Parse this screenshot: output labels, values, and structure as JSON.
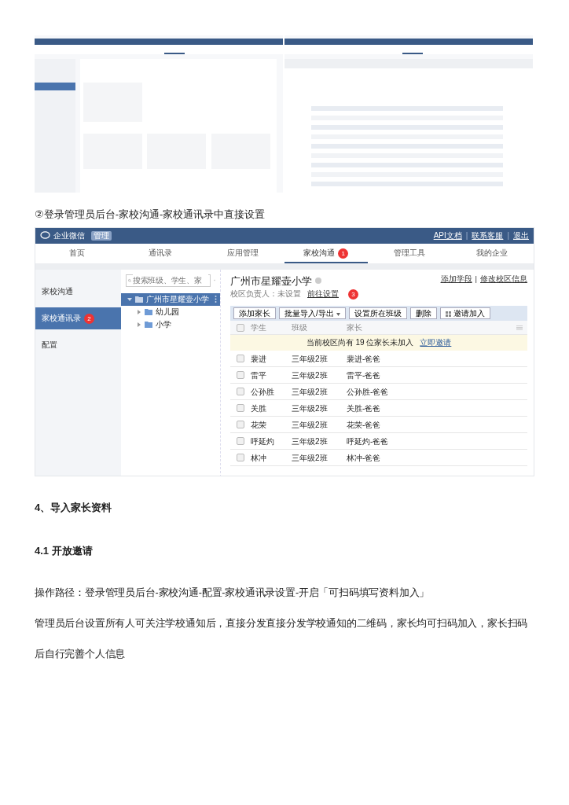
{
  "top_screenshots": [
    {
      "kind": "picture"
    },
    {
      "kind": "picture"
    }
  ],
  "caption": "②登录管理员后台-家校沟通-家校通讯录中直接设置",
  "app": {
    "logo": "企业微信",
    "logo_badge": "管理",
    "header_links": [
      "API文档",
      "联系客服",
      "退出"
    ],
    "header_separator": "|",
    "all_checked": false,
    "tabs": [
      {
        "label": "首页",
        "selected": false
      },
      {
        "label": "通讯录",
        "selected": false
      },
      {
        "label": "应用管理",
        "selected": false
      },
      {
        "label": "家校沟通",
        "selected": true,
        "badge": "1"
      },
      {
        "label": "管理工具",
        "selected": false
      },
      {
        "label": "我的企业",
        "selected": false
      }
    ],
    "sidebar": [
      {
        "label": "家校沟通",
        "selected": false
      },
      {
        "label": "家校通讯录",
        "selected": true,
        "badge": "2"
      },
      {
        "label": "配置",
        "selected": false
      }
    ],
    "search": {
      "placeholder": "搜索班级、学生、家"
    },
    "tree": [
      {
        "label": "广州市星耀壶小学",
        "expanded": true,
        "selected": true,
        "children": [
          {
            "label": "幼儿园",
            "expanded": false,
            "selected": false
          },
          {
            "label": "小学",
            "expanded": false,
            "selected": false
          }
        ]
      }
    ],
    "school": {
      "name": "广州市星耀壶小学",
      "manager_label": "校区负责人：未设置",
      "manager_link": "前往设置",
      "badge": "3",
      "links": [
        "添加学段",
        "修改校区信息"
      ],
      "separator": "|"
    },
    "toolbar": [
      {
        "label": "添加家长",
        "kind": "plain"
      },
      {
        "label": "批量导入/导出",
        "kind": "dropdown"
      },
      {
        "label": "设置所在班级",
        "kind": "plain"
      },
      {
        "label": "删除",
        "kind": "plain"
      },
      {
        "label": "邀请加入",
        "kind": "icon"
      }
    ],
    "columns": [
      "学生",
      "班级",
      "家长"
    ],
    "notice": {
      "text": "当前校区尚有 19 位家长未加入",
      "link": "立即邀请"
    },
    "rows": [
      {
        "student": "裴进",
        "class": "三年级2班",
        "parent": "裴进-爸爸",
        "checked": false
      },
      {
        "student": "雷平",
        "class": "三年级2班",
        "parent": "雷平-爸爸",
        "checked": false
      },
      {
        "student": "公孙胜",
        "class": "三年级2班",
        "parent": "公孙胜-爸爸",
        "checked": false
      },
      {
        "student": "关胜",
        "class": "三年级2班",
        "parent": "关胜-爸爸",
        "checked": false
      },
      {
        "student": "花荣",
        "class": "三年级2班",
        "parent": "花荣-爸爸",
        "checked": false
      },
      {
        "student": "呼延灼",
        "class": "三年级2班",
        "parent": "呼延灼-爸爸",
        "checked": false
      },
      {
        "student": "林冲",
        "class": "三年级2班",
        "parent": "林冲-爸爸",
        "checked": false
      }
    ]
  },
  "heading": "4、导入家长资料",
  "subheading": "4.1 开放邀请",
  "paragraphs": [
    "操作路径：登录管理员后台-家校沟通-配置-家校通讯录设置-开启「可扫码填写资料加入」",
    "管理员后台设置所有人可关注学校通知后，直接分发直接分发学校通知的二维码，家长均可扫码加入，家长扫码后自行完善个人信息"
  ]
}
